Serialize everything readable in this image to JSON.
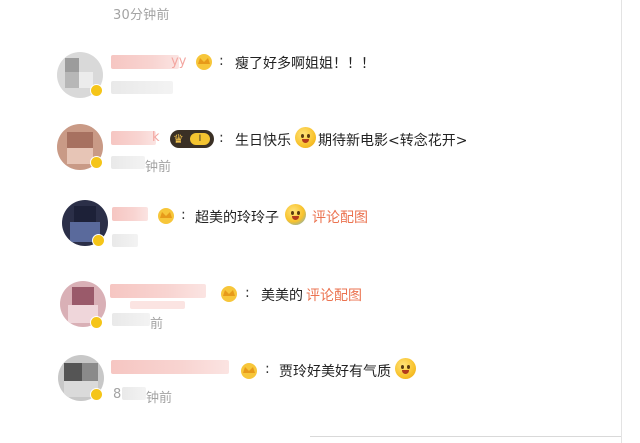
{
  "top_timestamp": "30分钟前",
  "comments": [
    {
      "name_tail": "yy",
      "text": "瘦了好多啊姐姐！！！",
      "link": "",
      "timestamp": ""
    },
    {
      "name_tail": "k",
      "text_before": "生日快乐",
      "text_after": "期待新电影<转念花开>",
      "timestamp_tail": "钟前"
    },
    {
      "text": "超美的玲玲子",
      "link": "评论配图",
      "timestamp": ""
    },
    {
      "text": "美美的",
      "link": "评论配图",
      "timestamp_tail": "前"
    },
    {
      "text": "贾玲好美好有气质",
      "timestamp_head": "8",
      "timestamp_tail": "钟前"
    }
  ],
  "colors": {
    "link": "#eb7350",
    "meta": "#a3a3a3",
    "name_blur": "#f6c6c2"
  },
  "icons": [
    "crown-badge-icon",
    "vip-badge-icon",
    "emoji-icon"
  ]
}
